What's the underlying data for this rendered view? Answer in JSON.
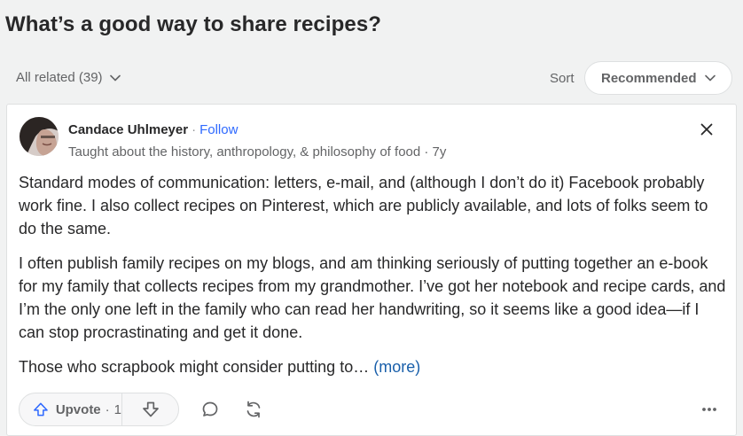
{
  "question": {
    "title": "What’s a good way to share recipes?"
  },
  "filters": {
    "all_related": "All related (39)",
    "sort_label": "Sort",
    "sort_value": "Recommended"
  },
  "answer": {
    "author_name": "Candace Uhlmeyer",
    "separator": "·",
    "follow_label": "Follow",
    "credential": "Taught about the history, anthropology, & philosophy of food · 7y",
    "paragraphs": [
      "Standard modes of communication: letters, e-mail, and (although I don’t do it) Facebook probably work fine. I also collect recipes on Pinterest, which are publicly available, and lots of folks seem to do the same.",
      "I often publish family recipes on my blogs, and am thinking seriously of putting together an e-book for my family that collects recipes from my grandmother. I’ve got her notebook and recipe cards, and I’m the only one left in the family who can read her handwriting, so it seems like a good idea—if I can stop procrastinating and get it done.",
      "Those who scrapbook might consider putting to…"
    ],
    "more_label": "(more)"
  },
  "actions": {
    "upvote_label": "Upvote",
    "separator": "·",
    "upvote_count": "1"
  },
  "icons": {
    "chevron": "chevron-down-icon",
    "close": "close-icon",
    "upvote": "upvote-arrow-icon",
    "downvote": "downvote-arrow-icon",
    "comment": "comment-icon",
    "share": "share-icon",
    "more": "more-icon"
  },
  "colors": {
    "accent_blue": "#2e69ff",
    "upvote_blue": "#2e69ff",
    "link_blue": "#195faa",
    "text": "#282829",
    "muted": "#636466",
    "background": "#f1f2f2"
  }
}
